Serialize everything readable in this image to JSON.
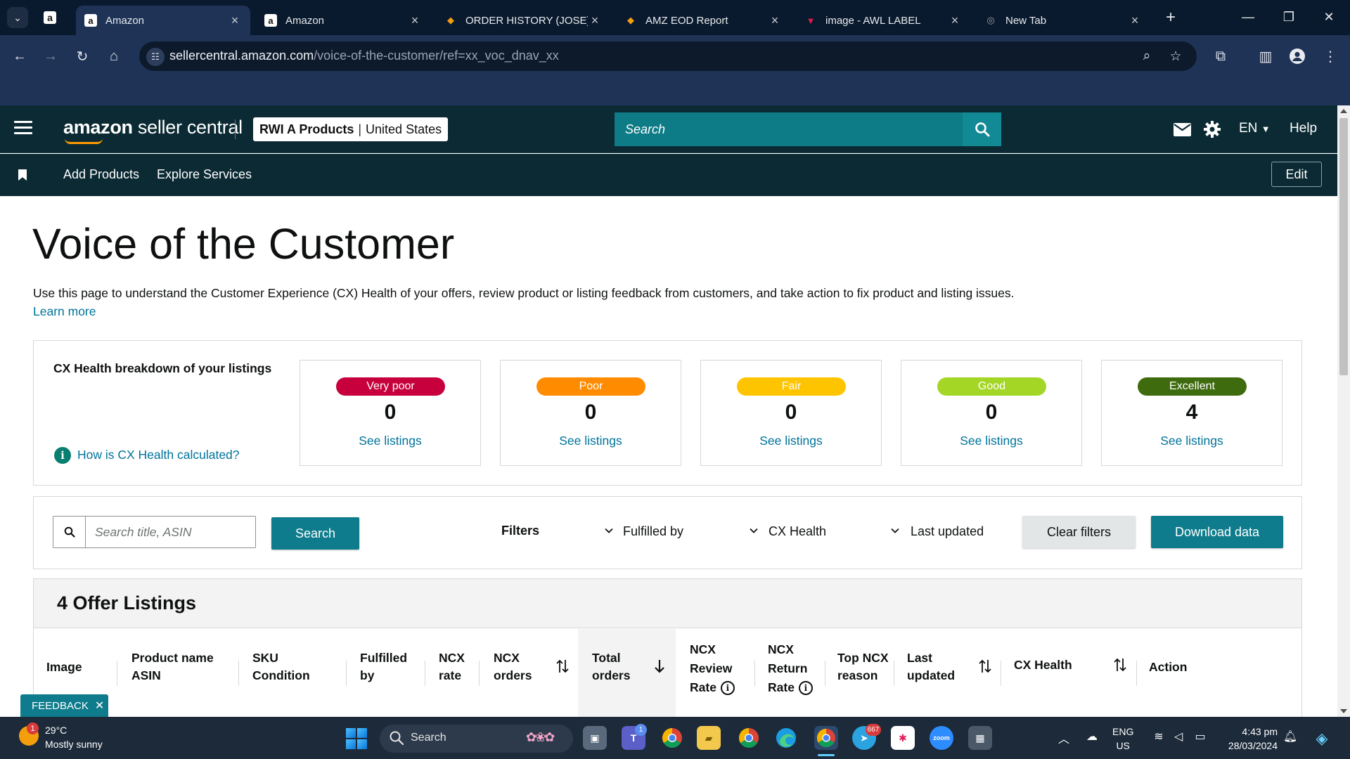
{
  "browser": {
    "tabs": [
      {
        "title": "Amazon",
        "favicon": "amazon-icon",
        "active": true
      },
      {
        "title": "Amazon",
        "favicon": "amazon-icon",
        "active": false
      },
      {
        "title": "ORDER HISTORY (JOSE)",
        "favicon": "zoho-icon",
        "active": false
      },
      {
        "title": "AMZ EOD Report",
        "favicon": "zoho-icon",
        "active": false
      },
      {
        "title": "image - AWL LABEL",
        "favicon": "awl-icon",
        "active": false
      },
      {
        "title": "New Tab",
        "favicon": "chrome-icon",
        "active": false
      }
    ],
    "url_host": "sellercentral.amazon.com",
    "url_path": "/voice-of-the-customer/ref=xx_voc_dnav_xx"
  },
  "header": {
    "logo_amazon": "amazon",
    "logo_rest": " seller central",
    "store_name": "RWI A Products",
    "store_separator": "|",
    "store_marketplace": "United States",
    "search_placeholder": "Search",
    "language": "EN",
    "help": "Help"
  },
  "subnav": {
    "items": [
      "Add Products",
      "Explore Services"
    ],
    "edit": "Edit"
  },
  "page": {
    "title": "Voice of the Customer",
    "description": "Use this page to understand the Customer Experience (CX) Health of your offers, review product or listing feedback from customers, and take action to fix product and listing issues.",
    "learn_more": "Learn more"
  },
  "cx_health": {
    "title": "CX Health breakdown of your listings",
    "calc_link": "How is CX Health calculated?",
    "tiles": [
      {
        "label": "Very poor",
        "count": "0",
        "link": "See listings",
        "color": "#c7003d",
        "text_color": "#ffffff"
      },
      {
        "label": "Poor",
        "count": "0",
        "link": "See listings",
        "color": "#ff8c00",
        "text_color": "#ffffff"
      },
      {
        "label": "Fair",
        "count": "0",
        "link": "See listings",
        "color": "#ffc400",
        "text_color": "#ffffff"
      },
      {
        "label": "Good",
        "count": "0",
        "link": "See listings",
        "color": "#a4d626",
        "text_color": "#ffffff"
      },
      {
        "label": "Excellent",
        "count": "4",
        "link": "See listings",
        "color": "#3e6b0e",
        "text_color": "#ffffff"
      }
    ]
  },
  "filters": {
    "search_placeholder": "Search title, ASIN",
    "search_button": "Search",
    "filters_label": "Filters",
    "dropdowns": [
      "Fulfilled by",
      "CX Health",
      "Last updated"
    ],
    "clear": "Clear filters",
    "download": "Download data"
  },
  "listings": {
    "title": "4 Offer Listings",
    "columns": [
      [
        "Image"
      ],
      [
        "Product name",
        "ASIN"
      ],
      [
        "SKU",
        "Condition"
      ],
      [
        "Fulfilled",
        "by"
      ],
      [
        "NCX",
        "rate"
      ],
      [
        "NCX",
        "orders"
      ],
      [
        "Total",
        "orders"
      ],
      [
        "NCX",
        "Review",
        "Rate"
      ],
      [
        "NCX",
        "Return",
        "Rate"
      ],
      [
        "Top NCX",
        "reason"
      ],
      [
        "Last",
        "updated"
      ],
      [
        "CX Health"
      ],
      [
        "Action"
      ]
    ]
  },
  "feedback": {
    "label": "FEEDBACK"
  },
  "taskbar": {
    "weather_temp": "29°C",
    "weather_desc": "Mostly sunny",
    "weather_badge": "1",
    "search": "Search",
    "teams_badge": "1",
    "telegram_badge": "667",
    "lang_top": "ENG",
    "lang_bottom": "US",
    "time": "4:43 pm",
    "date": "28/03/2024"
  },
  "colors": {
    "header_bg": "#0b2a33",
    "accent_teal": "#0e7c8c",
    "link": "#00739a"
  }
}
